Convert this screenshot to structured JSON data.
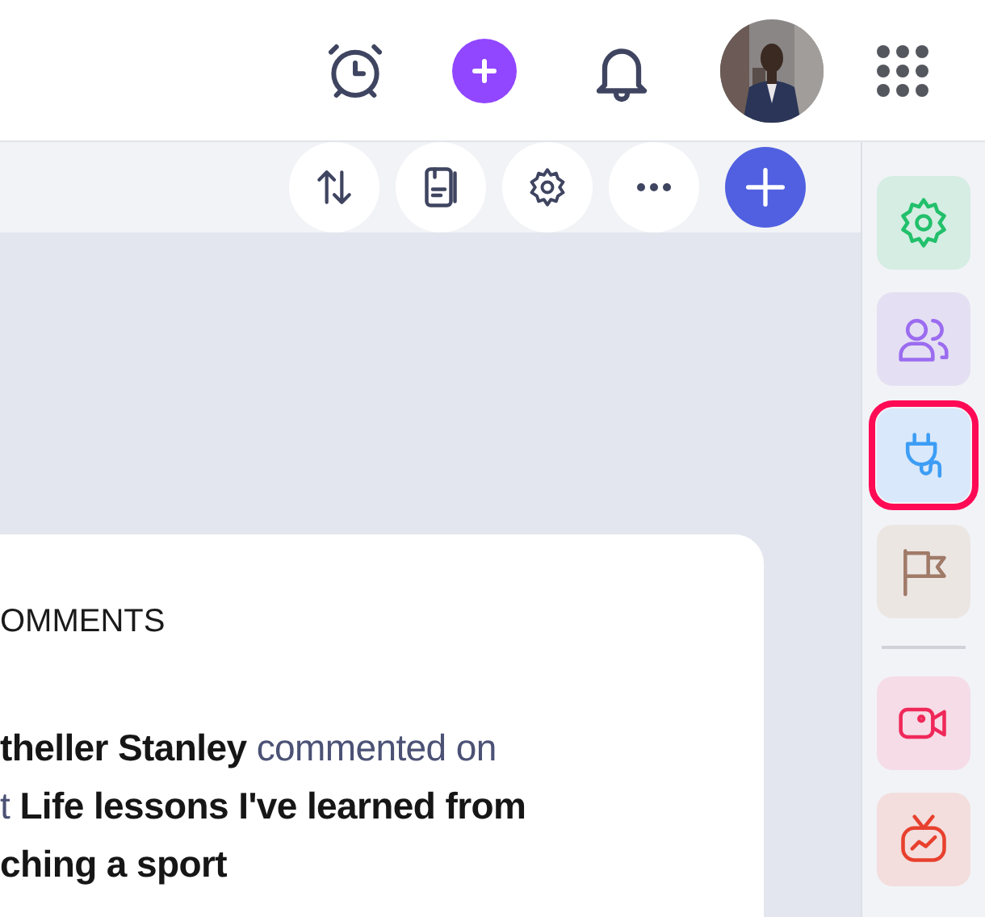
{
  "header": {
    "actions": [
      {
        "kind": "alarm"
      },
      {
        "kind": "add"
      },
      {
        "kind": "bell"
      },
      {
        "kind": "avatar"
      },
      {
        "kind": "apps"
      }
    ]
  },
  "toolbar": {
    "buttons": [
      {
        "kind": "sort"
      },
      {
        "kind": "document"
      },
      {
        "kind": "settings"
      },
      {
        "kind": "more"
      },
      {
        "kind": "add"
      }
    ]
  },
  "card": {
    "heading": "OMMENTS",
    "activity_lines": [
      "**theller Stanley** commented on",
      "t **Life lessons I've learned from**",
      "**ching a sport**"
    ]
  },
  "sidebar": {
    "items": [
      {
        "kind": "gear",
        "color": "#22c06b",
        "selected": false
      },
      {
        "kind": "people",
        "color": "#9b6cf0",
        "selected": false
      },
      {
        "kind": "plug",
        "color": "#3d9df5",
        "selected": true
      },
      {
        "kind": "flag",
        "color": "#a07a68",
        "selected": false
      },
      {
        "kind": "divider"
      },
      {
        "kind": "camera",
        "color": "#f0285a",
        "selected": false
      },
      {
        "kind": "tv",
        "color": "#e8402e",
        "selected": false
      }
    ]
  }
}
